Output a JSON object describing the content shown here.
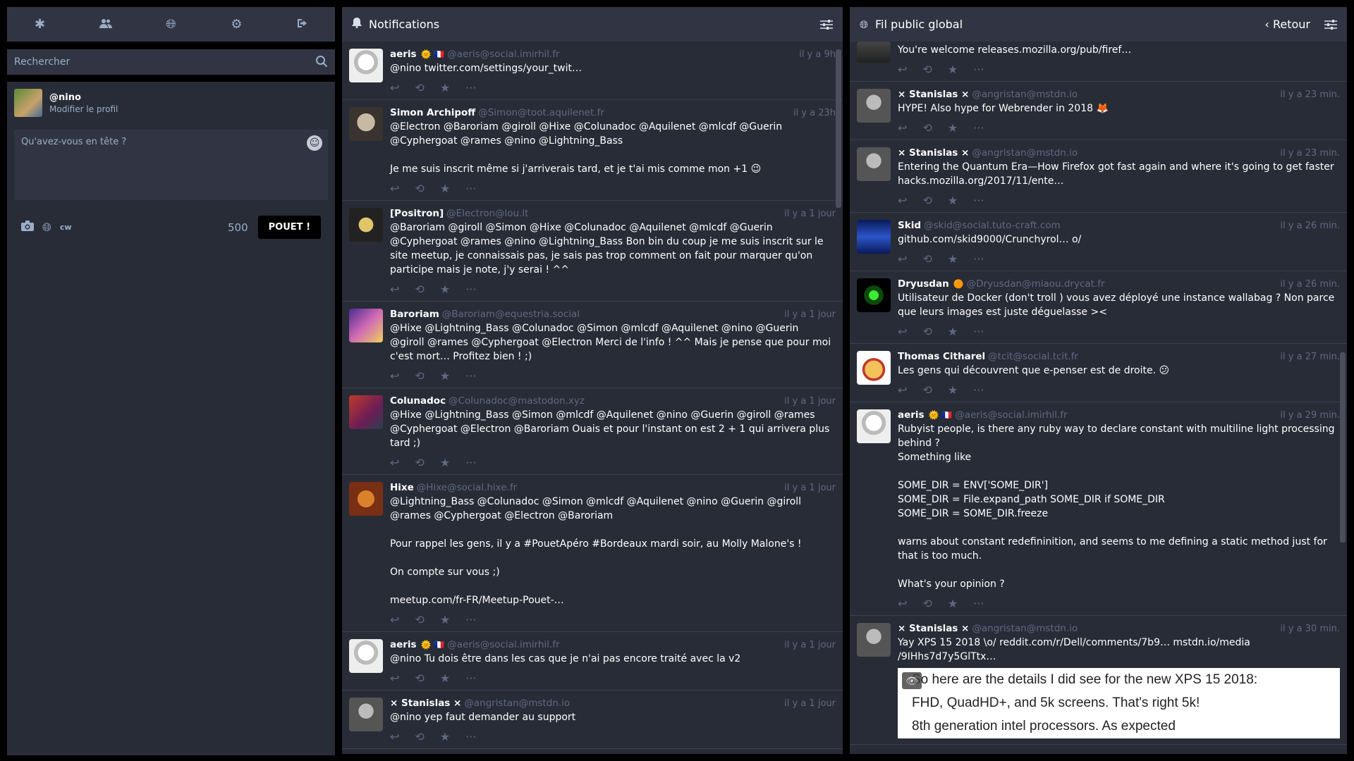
{
  "compose": {
    "nav_icons": [
      "asterisk-icon",
      "users-icon",
      "globe-icon",
      "gear-icon",
      "sign-out-icon"
    ],
    "search_placeholder": "Rechercher",
    "account_handle": "@nino",
    "edit_profile": "Modifier le profil",
    "compose_placeholder": "Qu'avez-vous en tête ?",
    "cw_label": "cw",
    "char_count": "500",
    "toot_label": "POUET !"
  },
  "notifications": {
    "title": "Notifications",
    "statuses": [
      {
        "name": "aeris",
        "handle": "@aeris@social.imirhil.fr",
        "time": "il y a 9h",
        "badge": "🌞 🇫🇷",
        "text": "@nino twitter.com/settings/your_twit…"
      },
      {
        "name": "Simon Archipoff",
        "handle": "@Simon@toot.aquilenet.fr",
        "time": "il y a 23h",
        "badge": "",
        "text": "@Electron @Baroriam @giroll @Hixe @Colunadoc @Aquilenet @mlcdf @Guerin\n@Cyphergoat @rames @nino @Lightning_Bass\n\nJe me suis inscrit même si j'arriverais tard, et je t'ai mis comme mon +1 😉"
      },
      {
        "name": "[Positron]",
        "handle": "@Electron@lou.lt",
        "time": "il y a 1 jour",
        "badge": "",
        "text": "@Baroriam @giroll @Simon @Hixe @Colunadoc @Aquilenet @mlcdf @Guerin\n@Cyphergoat @rames @nino @Lightning_Bass Bon bin du coup je me suis inscrit sur le site meetup, je connaissais pas, je sais pas trop comment on fait pour marquer qu'on participe mais je note, j'y serai ! ^^"
      },
      {
        "name": "Baroriam",
        "handle": "@Baroriam@equestria.social",
        "time": "il y a 1 jour",
        "badge": "",
        "text": "@Hixe @Lightning_Bass @Colunadoc @Simon @mlcdf @Aquilenet @nino @Guerin\n@giroll @rames @Cyphergoat @Electron Merci de l'info ! ^^ Mais je pense que pour moi c'est mort… Profitez bien ! ;)"
      },
      {
        "name": "Colunadoc",
        "handle": "@Colunadoc@mastodon.xyz",
        "time": "il y a 1 jour",
        "badge": "",
        "text": "@Hixe @Lightning_Bass @Simon @mlcdf @Aquilenet @nino @Guerin @giroll @rames\n@Cyphergoat @Electron @Baroriam Ouais et pour l'instant on est 2 + 1 qui arrivera plus tard ;)"
      },
      {
        "name": "Hixe",
        "handle": "@Hixe@social.hixe.fr",
        "time": "il y a 1 jour",
        "badge": "",
        "text": "@Lightning_Bass @Colunadoc @Simon @mlcdf @Aquilenet @nino @Guerin @giroll\n@rames @Cyphergoat @Electron @Baroriam\n\nPour rappel les gens, il y a #PouetApéro #Bordeaux mardi soir, au Molly Malone's !\n\nOn compte sur vous ;)\n\nmeetup.com/fr-FR/Meetup-Pouet-…"
      },
      {
        "name": "aeris",
        "handle": "@aeris@social.imirhil.fr",
        "time": "il y a 1 jour",
        "badge": "🌞 🇫🇷",
        "text": "@nino Tu dois être dans les cas que je n'ai pas encore traité avec la v2"
      },
      {
        "name": "× Stanislas ×",
        "handle": "@angristan@mstdn.io",
        "time": "il y a 1 jour",
        "badge": "",
        "text": "@nino yep faut demander au support"
      }
    ]
  },
  "public": {
    "title": "Fil public global",
    "back_label": "Retour",
    "top_partial_text": "You're welcome releases.mozilla.org/pub/firef…",
    "statuses": [
      {
        "name": "× Stanislas ×",
        "handle": "@angristan@mstdn.io",
        "time": "il y a 23 min.",
        "badge": "",
        "text": "HYPE! Also hype for Webrender in 2018 🦊"
      },
      {
        "name": "× Stanislas ×",
        "handle": "@angristan@mstdn.io",
        "time": "il y a 23 min.",
        "badge": "",
        "text": "Entering the Quantum Era—How Firefox got fast again and where it's going to get faster\nhacks.mozilla.org/2017/11/ente…"
      },
      {
        "name": "Skid",
        "handle": "@skid@social.tuto-craft.com",
        "time": "il y a 26 min.",
        "badge": "",
        "text": "github.com/skid9000/Crunchyrol… o/"
      },
      {
        "name": "Dryusdan",
        "handle": "@Dryusdan@miaou.drycat.fr",
        "time": "il y a 26 min.",
        "badge": "🟠",
        "text": "Utilisateur de Docker (don't troll ) vous avez déployé une instance wallabag ? Non parce que leurs images est juste déguelasse ><"
      },
      {
        "name": "Thomas Citharel",
        "handle": "@tcit@social.tcit.fr",
        "time": "il y a 27 min.",
        "badge": "",
        "text": "Les gens qui découvrent que e-penser est de droite. 😕"
      },
      {
        "name": "aeris",
        "handle": "@aeris@social.imirhil.fr",
        "time": "il y a 29 min.",
        "badge": "🌞 🇫🇷",
        "text": "Rubyist people, is there any ruby way to declare constant with multiline light processing behind ?\nSomething like\n\nSOME_DIR = ENV['SOME_DIR']\nSOME_DIR = File.expand_path SOME_DIR if SOME_DIR\nSOME_DIR = SOME_DIR.freeze\n\nwarns about constant redefininition, and seems to me defining a static method just for that is too much.\n\nWhat's your opinion ?"
      },
      {
        "name": "× Stanislas ×",
        "handle": "@angristan@mstdn.io",
        "time": "il y a 30 min.",
        "badge": "",
        "text": "Yay XPS 15 2018 \\o/ reddit.com/r/Dell/comments/7b9… mstdn.io/media\n/9IHhs7d7y5GlTtx…"
      }
    ],
    "media_lines": [
      "So here are the details I did see for the new XPS 15 2018:",
      "FHD, QuadHD+, and 5k screens. That's right 5k!",
      "8th generation intel processors. As expected"
    ]
  }
}
